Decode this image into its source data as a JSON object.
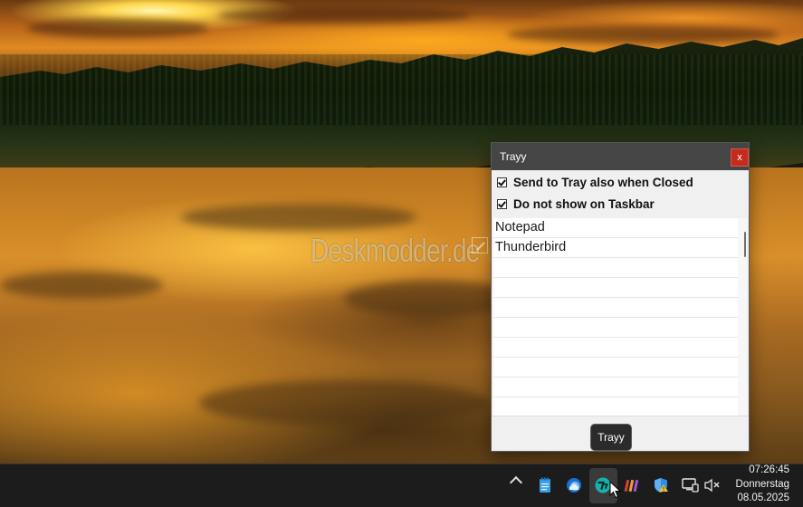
{
  "wallpaper": {
    "watermark": "Deskmodder.de"
  },
  "window": {
    "title": "Trayy",
    "close_label": "x",
    "options": [
      {
        "label": "Send to Tray also when Closed",
        "checked": true
      },
      {
        "label": "Do not show on Taskbar",
        "checked": true
      }
    ],
    "apps": [
      "Notepad",
      "Thunderbird"
    ]
  },
  "tooltip": {
    "text": "Trayy"
  },
  "taskbar": {
    "tray_icons": [
      "show-hidden-icons-chevron",
      "notepad-icon",
      "thunderbird-icon",
      "trayy-icon",
      "winrar-icon",
      "windows-security-icon",
      "network-icon",
      "volume-muted-icon"
    ],
    "clock": {
      "time": "07:26:45",
      "day": "Donnerstag",
      "date": "08.05.2025"
    }
  },
  "colors": {
    "titlebar": "#454545",
    "close_button": "#c42b1c",
    "taskbar": "#1c1c1c",
    "trayy_icon": "#1ab0a8"
  }
}
